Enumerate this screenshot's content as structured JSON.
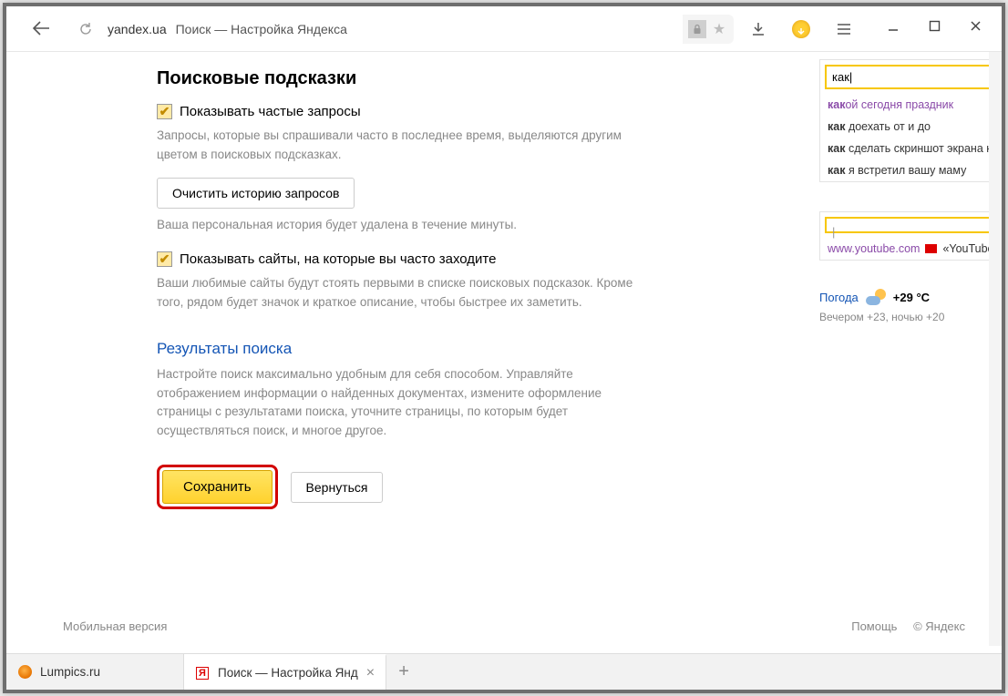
{
  "browser": {
    "domain": "yandex.ua",
    "title": "Поиск — Настройка Яндекса"
  },
  "section": {
    "heading": "Поисковые подсказки"
  },
  "opt1": {
    "label": "Показывать частые запросы",
    "desc": "Запросы, которые вы спрашивали часто в последнее время, выделяются другим цветом в поисковых подсказках.",
    "clear_btn": "Очистить историю запросов",
    "clear_note": "Ваша персональная история будет удалена в течение минуты."
  },
  "opt2": {
    "label": "Показывать сайты, на которые вы часто заходите",
    "desc": "Ваши любимые сайты будут стоять первыми в списке поисковых подсказок. Кроме того, рядом будет значок и краткое описание, чтобы быстрее их заметить."
  },
  "results": {
    "title": "Результаты поиска",
    "desc": "Настройте поиск максимально удобным для себя способом. Управляйте отображением информации о найденных документах, измените оформление страницы с результатами поиска, уточните страницы, по которым будет осуществляться поиск, и многое другое."
  },
  "buttons": {
    "save": "Сохранить",
    "back": "Вернуться"
  },
  "preview1": {
    "query": "как",
    "sugg1_pfx": "как",
    "sugg1_rest": "ой сегодня праздник",
    "sugg2_pfx": "как",
    "sugg2_rest": " доехать от и до",
    "sugg3_pfx": "как",
    "sugg3_rest": " сделать скриншот экрана на компь",
    "sugg4_pfx": "как",
    "sugg4_rest": " я встретил вашу маму"
  },
  "preview2": {
    "cursor": "|",
    "url": "www.youtube.com",
    "desc": "«YouTube» —"
  },
  "weather": {
    "label": "Погода",
    "temp": "+29 °C",
    "sub": "Вечером +23,  ночью +20"
  },
  "footer": {
    "mobile": "Мобильная версия",
    "help": "Помощь",
    "copy": "© Яндекс"
  },
  "tabs": {
    "t1": "Lumpics.ru",
    "t2": "Поиск — Настройка Янд",
    "yletter": "Я"
  }
}
